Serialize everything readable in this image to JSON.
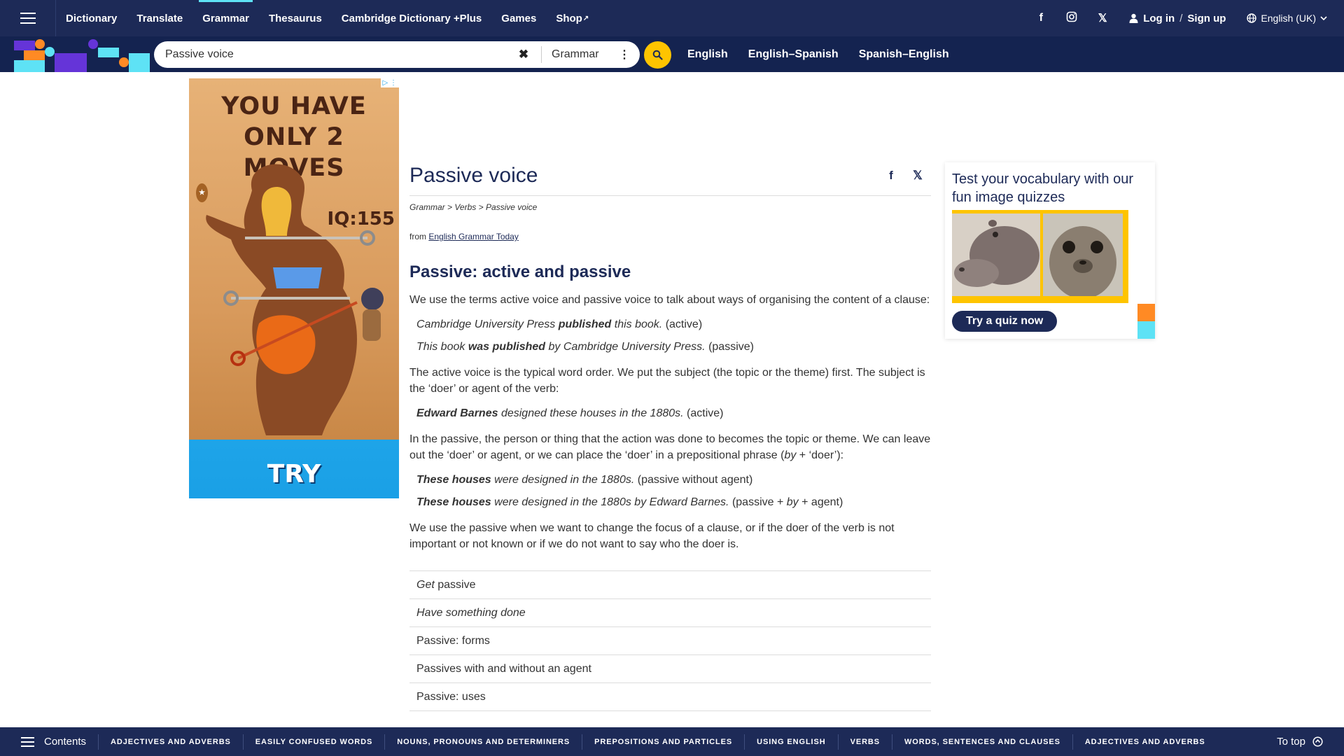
{
  "nav": {
    "items": [
      {
        "label": "Dictionary"
      },
      {
        "label": "Translate"
      },
      {
        "label": "Grammar",
        "active": true
      },
      {
        "label": "Thesaurus"
      },
      {
        "label": "Cambridge Dictionary +Plus"
      },
      {
        "label": "Games"
      },
      {
        "label": "Shop"
      }
    ],
    "login_label": "Log in",
    "slash": "/",
    "signup_label": "Sign up",
    "language": "English (UK)"
  },
  "search": {
    "query": "Passive voice",
    "scope": "Grammar",
    "dictionaries": [
      "English",
      "English–Spanish",
      "Spanish–English"
    ]
  },
  "ad": {
    "headline_1": "YOU HAVE",
    "headline_2": "ONLY 2 MOVES",
    "iq_label": "IQ:155",
    "cta": "TRY"
  },
  "article": {
    "title": "Passive voice",
    "breadcrumb": [
      "Grammar",
      "Verbs",
      "Passive voice"
    ],
    "from_prefix": "from",
    "source": "English Grammar Today",
    "heading": "Passive: active and passive",
    "p1": "We use the terms active voice and passive voice to talk about ways of organising the content of a clause:",
    "ex1": {
      "a": "Cambridge University Press",
      "b": "published",
      "c": "this book.",
      "d": "(active)"
    },
    "ex2": {
      "a": "This book",
      "b": "was published",
      "c": "by Cambridge University Press.",
      "d": "(passive)"
    },
    "p2": "The active voice is the typical word order. We put the subject (the topic or the theme) first. The subject is the ‘doer’ or agent of the verb:",
    "ex3": {
      "a": "Edward Barnes",
      "b": "designed these houses in the 1880s.",
      "c": "(active)"
    },
    "p3_main": "In the passive, the person or thing that the action was done to becomes the topic or theme. We can leave out the ‘doer’ or agent, or we can place the ‘doer’ in a prepositional phrase (",
    "p3_by": "by",
    "p3_end": "+ ‘doer’):",
    "ex4": {
      "a": "These houses",
      "b": "were designed in the 1880s.",
      "c": "(passive without agent)"
    },
    "ex5": {
      "a": "These houses",
      "b": "were designed in the 1880s by Edward Barnes.",
      "c": "(passive +",
      "d": "by",
      "e": "+ agent)"
    },
    "p4": "We use the passive when we want to change the focus of a clause, or if the doer of the verb is not important or not known or if we do not want to say who the doer is.",
    "related": {
      "get_a": "Get",
      "get_b": "passive",
      "have": "Have something done",
      "forms": "Passive: forms",
      "agent": "Passives with and without an agent",
      "uses": "Passive: uses"
    }
  },
  "quiz": {
    "title": "Test your vocabulary with our fun image quizzes",
    "button": "Try a quiz now"
  },
  "bottom": {
    "contents": "Contents",
    "categories": [
      "ADJECTIVES AND ADVERBS",
      "EASILY CONFUSED WORDS",
      "NOUNS, PRONOUNS AND DETERMINERS",
      "PREPOSITIONS AND PARTICLES",
      "USING ENGLISH",
      "VERBS",
      "WORDS, SENTENCES AND CLAUSES",
      "ADJECTIVES AND ADVERBS"
    ],
    "to_top": "To top"
  },
  "colors": {
    "nav_bg": "#1d2a57",
    "search_bg": "#142350",
    "accent_yellow": "#fec400",
    "accent_cyan": "#5ee2f5",
    "accent_orange": "#ff8a24",
    "accent_purple": "#6534d8"
  },
  "icons": [
    "menu-icon",
    "facebook-icon",
    "instagram-icon",
    "x-icon",
    "user-icon",
    "globe-icon",
    "chevron-down-icon",
    "clear-icon",
    "kebab-icon",
    "search-icon",
    "up-arrow-icon"
  ]
}
